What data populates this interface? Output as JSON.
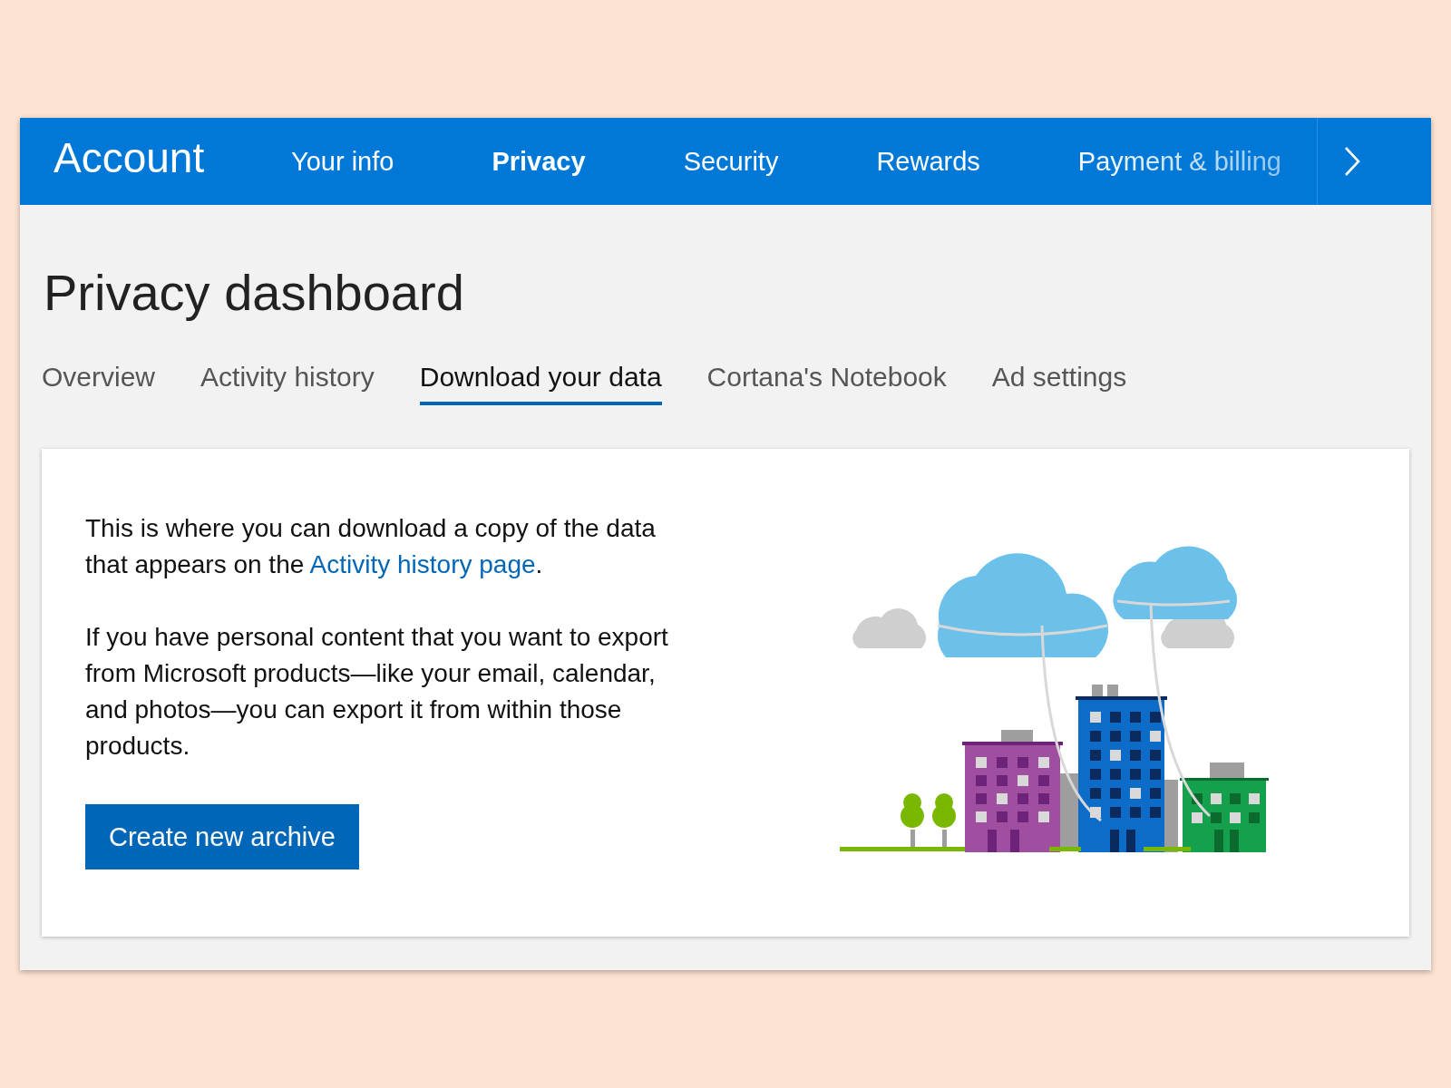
{
  "header": {
    "brand": "Account",
    "nav": [
      {
        "label": "Your info",
        "selected": false
      },
      {
        "label": "Privacy",
        "selected": true
      },
      {
        "label": "Security",
        "selected": false
      },
      {
        "label": "Rewards",
        "selected": false
      },
      {
        "label": "Payment & billing",
        "selected": false
      }
    ]
  },
  "title": "Privacy dashboard",
  "tabs": [
    {
      "label": "Overview",
      "selected": false
    },
    {
      "label": "Activity history",
      "selected": false
    },
    {
      "label": "Download your data",
      "selected": true
    },
    {
      "label": "Cortana's Notebook",
      "selected": false
    },
    {
      "label": "Ad settings",
      "selected": false
    }
  ],
  "card": {
    "intro": {
      "before": "This is where you can download a copy of the data that appears on the ",
      "link": "Activity history page",
      "after": "."
    },
    "paragraph": "If you have personal content that you want to export from Microsoft products—like your email, calendar, and photos—you can export it from within those products.",
    "button": "Create new archive"
  }
}
